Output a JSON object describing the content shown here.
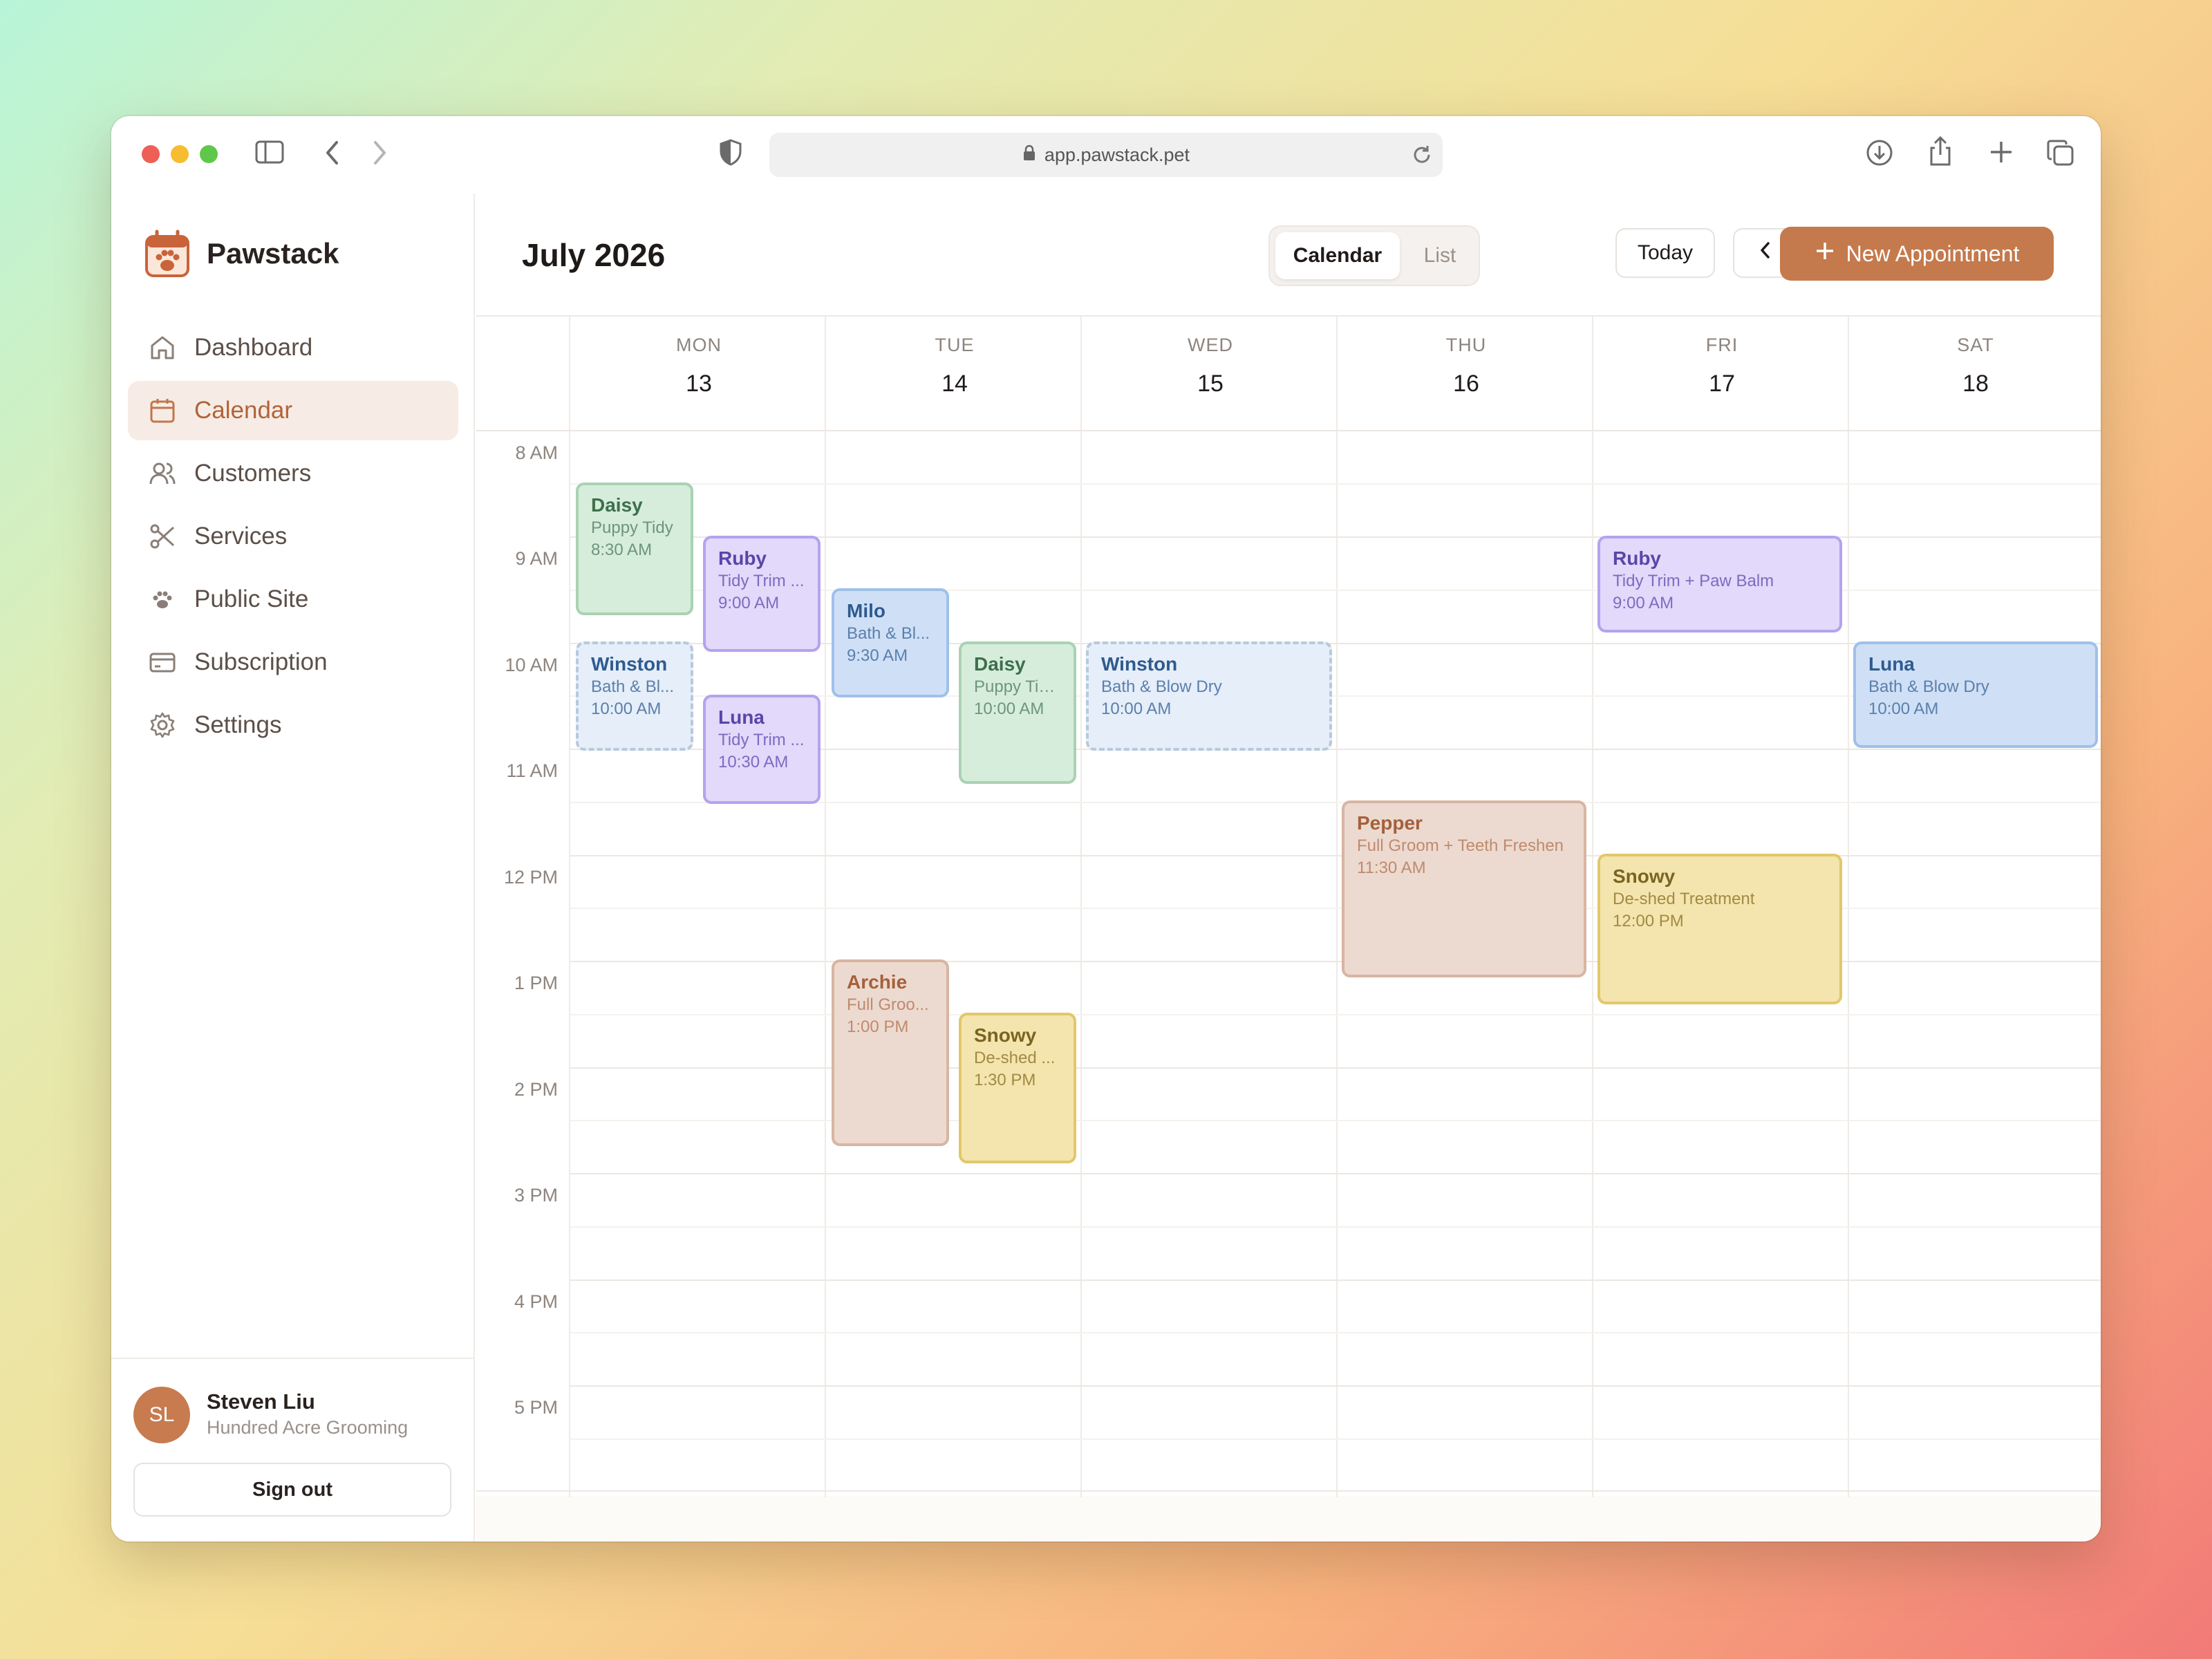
{
  "browser": {
    "url": "app.pawstack.pet"
  },
  "colors": {
    "accent": "#c47a4c",
    "active_nav_bg": "#f7ece5"
  },
  "app": {
    "name": "Pawstack"
  },
  "sidebar": {
    "items": [
      {
        "label": "Dashboard",
        "icon": "home-icon"
      },
      {
        "label": "Calendar",
        "icon": "calendar-icon",
        "active": true
      },
      {
        "label": "Customers",
        "icon": "users-icon"
      },
      {
        "label": "Services",
        "icon": "scissors-icon"
      },
      {
        "label": "Public Site",
        "icon": "paw-icon"
      },
      {
        "label": "Subscription",
        "icon": "credit-card-icon"
      },
      {
        "label": "Settings",
        "icon": "gear-icon"
      }
    ]
  },
  "user": {
    "initials": "SL",
    "name": "Steven Liu",
    "org": "Hundred Acre Grooming",
    "signout_label": "Sign out"
  },
  "header": {
    "month": "July 2026",
    "view_calendar": "Calendar",
    "view_list": "List",
    "today_label": "Today",
    "new_appointment_label": "New Appointment"
  },
  "calendar": {
    "days": [
      {
        "dow": "MON",
        "num": "13"
      },
      {
        "dow": "TUE",
        "num": "14"
      },
      {
        "dow": "WED",
        "num": "15"
      },
      {
        "dow": "THU",
        "num": "16"
      },
      {
        "dow": "FRI",
        "num": "17"
      },
      {
        "dow": "SAT",
        "num": "18"
      }
    ],
    "hours": [
      "8 AM",
      "9 AM",
      "10 AM",
      "11 AM",
      "12 PM",
      "1 PM",
      "2 PM",
      "3 PM",
      "4 PM",
      "5 PM"
    ],
    "appointments": [
      {
        "pet": "Daisy",
        "service": "Puppy Tidy",
        "time": "8:30 AM",
        "color": "green"
      },
      {
        "pet": "Ruby",
        "service": "Tidy Trim ...",
        "time": "9:00 AM",
        "color": "purple"
      },
      {
        "pet": "Winston",
        "service": "Bath & Bl...",
        "time": "10:00 AM",
        "color": "bluedash"
      },
      {
        "pet": "Luna",
        "service": "Tidy Trim ...",
        "time": "10:30 AM",
        "color": "purple"
      },
      {
        "pet": "Milo",
        "service": "Bath & Bl...",
        "time": "9:30 AM",
        "color": "blue"
      },
      {
        "pet": "Daisy",
        "service": "Puppy Tid...",
        "time": "10:00 AM",
        "color": "green"
      },
      {
        "pet": "Archie",
        "service": "Full Groo...",
        "time": "1:00 PM",
        "color": "tan"
      },
      {
        "pet": "Snowy",
        "service": "De-shed ...",
        "time": "1:30 PM",
        "color": "yellow"
      },
      {
        "pet": "Winston",
        "service": "Bath & Blow Dry",
        "time": "10:00 AM",
        "color": "bluedash"
      },
      {
        "pet": "Pepper",
        "service": "Full Groom + Teeth Freshen",
        "time": "11:30 AM",
        "color": "tan"
      },
      {
        "pet": "Ruby",
        "service": "Tidy Trim + Paw Balm",
        "time": "9:00 AM",
        "color": "purple"
      },
      {
        "pet": "Snowy",
        "service": "De-shed Treatment",
        "time": "12:00 PM",
        "color": "yellow"
      },
      {
        "pet": "Luna",
        "service": "Bath & Blow Dry",
        "time": "10:00 AM",
        "color": "blue"
      }
    ]
  }
}
